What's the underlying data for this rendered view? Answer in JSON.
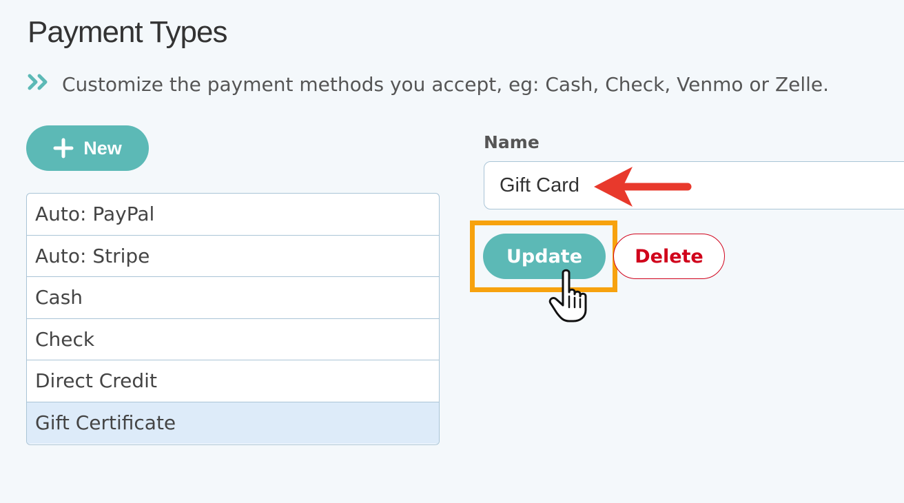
{
  "page": {
    "title": "Payment Types",
    "subtitle": "Customize the payment methods you accept, eg: Cash, Check, Venmo or Zelle."
  },
  "toolbar": {
    "new_label": "New"
  },
  "payment_types": [
    {
      "label": "Auto: PayPal",
      "selected": false
    },
    {
      "label": "Auto: Stripe",
      "selected": false
    },
    {
      "label": "Cash",
      "selected": false
    },
    {
      "label": "Check",
      "selected": false
    },
    {
      "label": "Direct Credit",
      "selected": false
    },
    {
      "label": "Gift Certificate",
      "selected": true
    }
  ],
  "form": {
    "name_label": "Name",
    "name_value": "Gift Card",
    "update_label": "Update",
    "delete_label": "Delete"
  },
  "icons": {
    "subtitle_icon": "double-chevron-right-icon",
    "new_icon": "plus-icon",
    "annotation_arrow": "red-arrow-icon",
    "cursor": "hand-pointer-icon"
  },
  "colors": {
    "accent": "#5cb9b6",
    "danger": "#d0021b",
    "highlight": "#f7a20e",
    "selected_row": "#ddebf9",
    "background": "#f4f8fb"
  }
}
